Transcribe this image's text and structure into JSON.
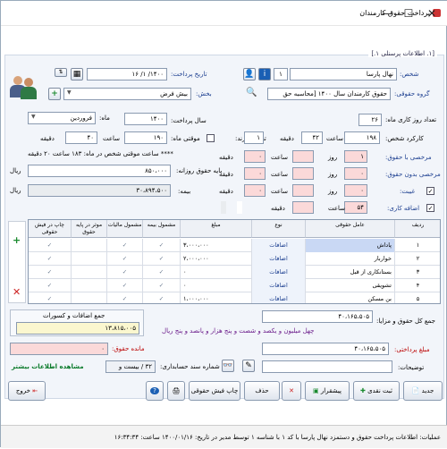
{
  "window": {
    "title": "پرداخت حقوق کارمندان",
    "minimize": "—",
    "maximize": "☐",
    "close": "✕"
  },
  "section_title": "[۱. اطلاعات پرسنلی ۱.]",
  "person": {
    "label": "شخص:",
    "name": "نهال پارسا",
    "code": "۱"
  },
  "salary_group": {
    "label": "گروه حقوقی:",
    "value": "حقوق کارمندان سال ۱۴۰۰ [محاسبه حق"
  },
  "pay_date": {
    "label": "تاریخ پرداخت:",
    "value": "۱۴۰۰/ ۱/ ۱۶"
  },
  "section_branch": {
    "label": "بخش:",
    "value": "بیش فرض"
  },
  "work_days": {
    "label": "تعداد روز کاری ماه:",
    "value": "۲۶"
  },
  "pay_year": {
    "label": "سال پرداخت:",
    "value": "۱۴۰۰"
  },
  "month": {
    "label": "ماه:",
    "value": "فروردین"
  },
  "work_hours": {
    "label": "کارکرد شخص:",
    "hours": "۱۹۸",
    "hours_unit": "ساعت",
    "minutes": "۴۲",
    "minutes_unit": "دقیقه"
  },
  "children": {
    "label": "تعداد فرزند:",
    "value": "۱"
  },
  "temp": {
    "label": "موقتی ماه:",
    "value": "۱۹۰",
    "hours_unit": "ساعت",
    "minutes": "۴۰",
    "minutes_unit": "دقیقه"
  },
  "leave_paid": {
    "label": "مرخصی با حقوق:",
    "days": "۱",
    "days_unit": "روز",
    "hours": "",
    "hours_unit": "ساعت",
    "minutes": "۰",
    "minutes_unit": "دقیقه"
  },
  "leave_unpaid": {
    "label": "مرخصی بدون حقوق:",
    "days": "۰",
    "days_unit": "روز",
    "hours": "",
    "hours_unit": "ساعت",
    "minutes": "۰",
    "minutes_unit": "دقیقه"
  },
  "absence": {
    "label": "غیبت:",
    "days": "۰",
    "days_unit": "روز",
    "hours": "",
    "hours_unit": "ساعت",
    "minutes": "۰",
    "minutes_unit": "دقیقه",
    "rial": "ریال"
  },
  "overtime": {
    "label": "اضافه کاری:",
    "hours": "۵۴",
    "hours_unit": "ساعت",
    "minutes": "",
    "minutes_unit": "دقیقه",
    "amount": "۱،۷۱۰،۰۰۵",
    "rial": "ریال"
  },
  "temp_note": "**** ساعت موقتی شخص در ماه: ۱۸۳ ساعت ۲۰ دقیقه",
  "daily_salary": {
    "label": "پایه حقوق روزانه:",
    "value": "۸۵۰،۰۰۰",
    "rial": "ریال"
  },
  "base_total": {
    "value": "۳۰،۸۹۴،۵۰۰",
    "rial": "ریال"
  },
  "insurance": {
    "label": "بیمه:",
    "value": "۷",
    "rial": "ریال"
  },
  "tax": {
    "label": "مالیات:",
    "value": "۰",
    "rial": "ریال"
  },
  "grid": {
    "headers": [
      "ردیف",
      "عامل حقوقی",
      "نوع",
      "مبلغ",
      "مشمول بیمه",
      "مشمول مالیات",
      "موثر در پایه حقوق",
      "چاپ در فیش حقوقی"
    ],
    "rows": [
      {
        "n": "۱",
        "name": "پاداش",
        "type": "اضافات",
        "amount": "۳،۰۰۰،۰۰۰",
        "ins": "✓",
        "tax": "✓",
        "base": "",
        "print": "✓"
      },
      {
        "n": "۲",
        "name": "خواربار",
        "type": "اضافات",
        "amount": "۲،۰۰۰،۰۰۰",
        "ins": "✓",
        "tax": "✓",
        "base": "",
        "print": "✓"
      },
      {
        "n": "۳",
        "name": "بستانکاری از قبل",
        "type": "اضافات",
        "amount": "۰",
        "ins": "✓",
        "tax": "✓",
        "base": "",
        "print": "✓"
      },
      {
        "n": "۴",
        "name": "تشویقی",
        "type": "اضافات",
        "amount": "۰",
        "ins": "✓",
        "tax": "✓",
        "base": "",
        "print": "✓"
      },
      {
        "n": "۵",
        "name": "بن مسکن",
        "type": "اضافات",
        "amount": "۱،۰۰۰،۰۰۰",
        "ins": "✓",
        "tax": "✓",
        "base": "",
        "print": "✓"
      }
    ]
  },
  "totals_box": {
    "title": "جمع اضافات و کسورات",
    "value": "۱۳،۸۱۵،۰۰۵"
  },
  "gross": {
    "label": "جمع کل حقوق و مزایا:",
    "value": "۴۰،۱۶۵،۵۰۵",
    "words": "چهل میلیون و یکصد و شصت و پنج هزار و پانصد و پنج ریال"
  },
  "remaining": {
    "label": "مانده حقوق:",
    "value": "۰"
  },
  "more_info": "مشاهده اطلاعات بیشتر",
  "voucher": {
    "label": "شماره سند حسابداری:",
    "value": "۳۲ / بیست و"
  },
  "payable": {
    "label": "مبلغ پرداختی:",
    "value": "۴۰،۱۶۵،۵۰۵"
  },
  "notes": {
    "label": "توضیحات:",
    "value": ""
  },
  "buttons": {
    "new": "جدید",
    "cash": "ثبت نقدی",
    "advance": "پیشقرار",
    "delete": "حذف",
    "print_slip": "چاپ فیش حقوقی",
    "exit": "خروج"
  },
  "status": "عملیات: اطلاعات پرداخت حقوق و دستمزد نهال پارسا با کد ۱ با شناسه ۱ توسط مدیر در تاریخ: ۱۴۰۰/۰۱/۱۶ ساعت: ۱۶:۳۴:۳۴",
  "colors": {
    "accent": "#1a3d8f",
    "pink": "#fbd9d9",
    "green_text": "#0a7a2a",
    "red_text": "#b00"
  }
}
